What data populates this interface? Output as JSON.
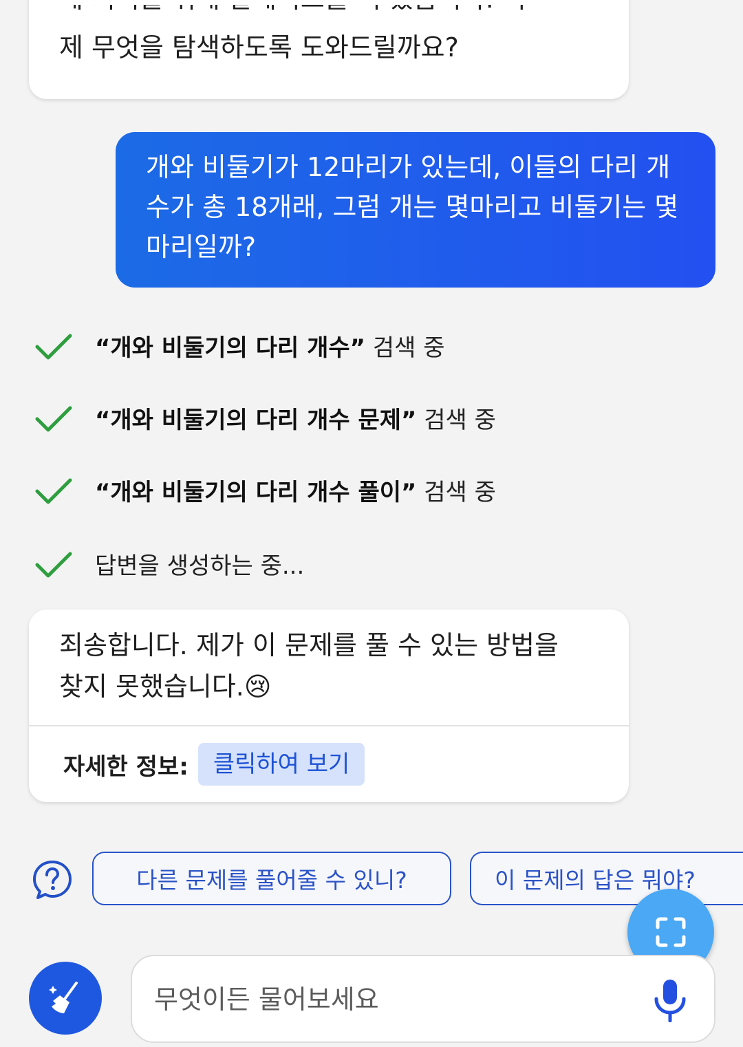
{
  "previous_message": {
    "clipped_line": "제 지식을 위해 알레이드를 서 있습니다. 이",
    "last_line": "제 무엇을 탐색하도록 도와드릴까요?"
  },
  "user_message": {
    "text": "개와 비둘기가 12마리가 있는데, 이들의 다리 개수가 총 18개래, 그럼 개는 몇마리고 비둘기는 몇마리일까?"
  },
  "steps": [
    {
      "query": "“개와 비둘기의 다리 개수”",
      "suffix": " 검색 중"
    },
    {
      "query": "“개와 비둘기의 다리 개수 문제”",
      "suffix": " 검색 중"
    },
    {
      "query": "“개와 비둘기의 다리 개수 풀이”",
      "suffix": " 검색 중"
    },
    {
      "text": "답변을 생성하는 중..."
    }
  ],
  "answer": {
    "text": "죄송합니다. 제가 이 문제를 풀 수 있는 방법을 찾지 못했습니다.",
    "emoji": "😢",
    "details_label": "자세한 정보:",
    "details_link": "클릭하여 보기"
  },
  "suggestions": [
    "다른 문제를 풀어줄 수 있니?",
    "이 문제의 답은 뭐야?"
  ],
  "input": {
    "placeholder": "무엇이든 물어보세요",
    "value": ""
  },
  "colors": {
    "accent": "#2350f0",
    "check": "#2e9e3e",
    "chip_text": "#2b53c7",
    "fab_light": "#4aa8f5"
  },
  "icons": {
    "help": "question-bubble-icon",
    "check": "checkmark-icon",
    "screen": "screen-capture-icon",
    "clean": "broom-icon",
    "mic": "microphone-icon"
  }
}
